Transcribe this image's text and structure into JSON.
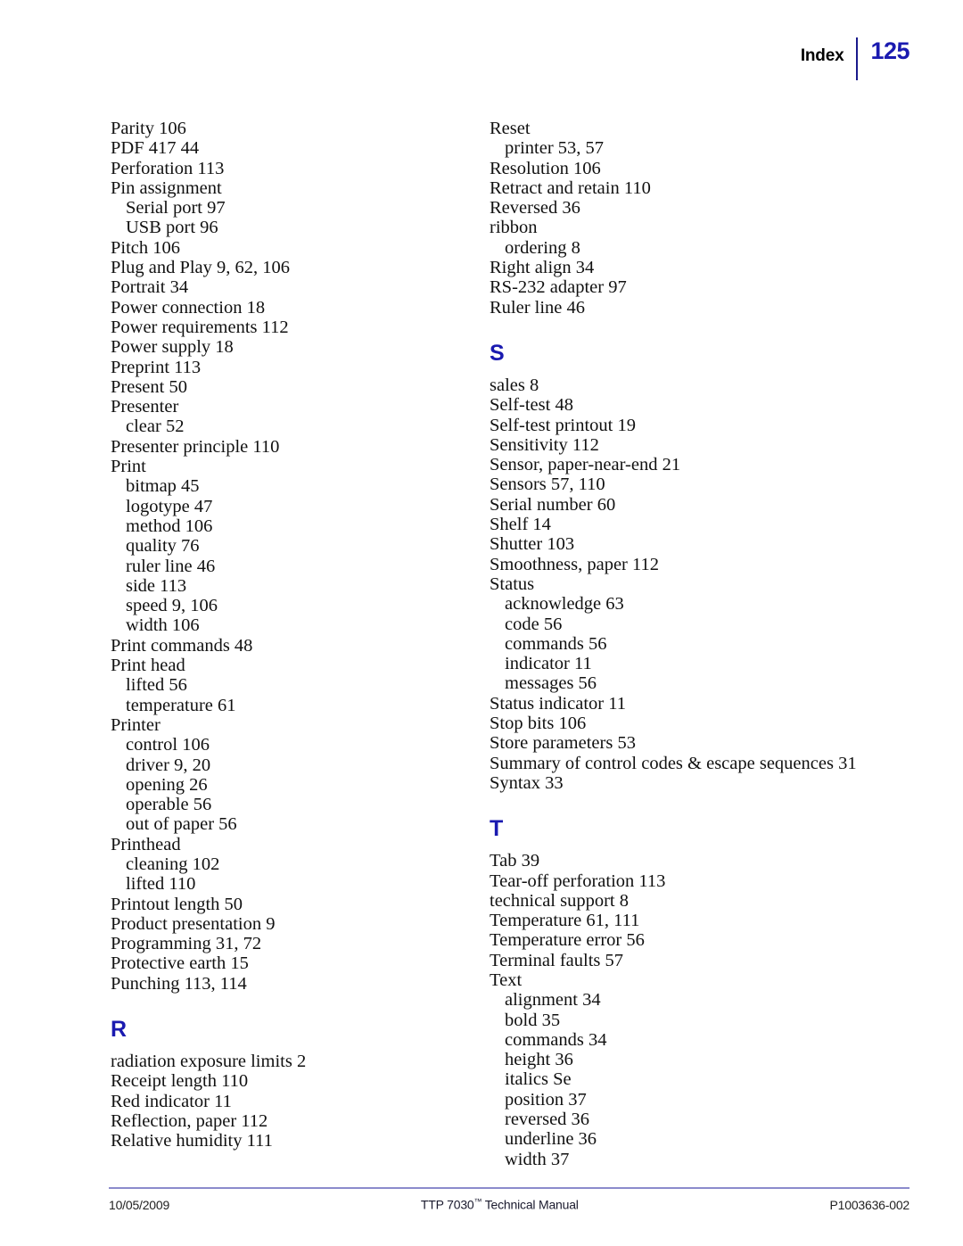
{
  "header": {
    "label": "Index",
    "page_number": "125",
    "divider_color": "#1a1a8c",
    "page_number_color": "#1a1ab0"
  },
  "footer": {
    "date": "10/05/2009",
    "manual_title": "TTP 7030",
    "manual_title_suffix": " Technical Manual",
    "trademark": "™",
    "document_number": "P1003636-002",
    "rule_color": "#8b8bcc"
  },
  "columns": {
    "left": [
      {
        "type": "entry",
        "level": 1,
        "text": "Parity 106"
      },
      {
        "type": "entry",
        "level": 1,
        "text": "PDF 417 44"
      },
      {
        "type": "entry",
        "level": 1,
        "text": "Perforation 113"
      },
      {
        "type": "entry",
        "level": 1,
        "text": "Pin assignment"
      },
      {
        "type": "entry",
        "level": 2,
        "text": "Serial port 97"
      },
      {
        "type": "entry",
        "level": 2,
        "text": "USB port 96"
      },
      {
        "type": "entry",
        "level": 1,
        "text": "Pitch 106"
      },
      {
        "type": "entry",
        "level": 1,
        "text": "Plug and Play 9, 62, 106"
      },
      {
        "type": "entry",
        "level": 1,
        "text": "Portrait 34"
      },
      {
        "type": "entry",
        "level": 1,
        "text": "Power connection 18"
      },
      {
        "type": "entry",
        "level": 1,
        "text": "Power requirements 112"
      },
      {
        "type": "entry",
        "level": 1,
        "text": "Power supply 18"
      },
      {
        "type": "entry",
        "level": 1,
        "text": "Preprint 113"
      },
      {
        "type": "entry",
        "level": 1,
        "text": "Present 50"
      },
      {
        "type": "entry",
        "level": 1,
        "text": "Presenter"
      },
      {
        "type": "entry",
        "level": 2,
        "text": "clear 52"
      },
      {
        "type": "entry",
        "level": 1,
        "text": "Presenter principle 110"
      },
      {
        "type": "entry",
        "level": 1,
        "text": "Print"
      },
      {
        "type": "entry",
        "level": 2,
        "text": "bitmap 45"
      },
      {
        "type": "entry",
        "level": 2,
        "text": "logotype 47"
      },
      {
        "type": "entry",
        "level": 2,
        "text": "method 106"
      },
      {
        "type": "entry",
        "level": 2,
        "text": "quality 76"
      },
      {
        "type": "entry",
        "level": 2,
        "text": "ruler line 46"
      },
      {
        "type": "entry",
        "level": 2,
        "text": "side 113"
      },
      {
        "type": "entry",
        "level": 2,
        "text": "speed 9, 106"
      },
      {
        "type": "entry",
        "level": 2,
        "text": "width 106"
      },
      {
        "type": "entry",
        "level": 1,
        "text": "Print commands 48"
      },
      {
        "type": "entry",
        "level": 1,
        "text": "Print head"
      },
      {
        "type": "entry",
        "level": 2,
        "text": "lifted 56"
      },
      {
        "type": "entry",
        "level": 2,
        "text": "temperature 61"
      },
      {
        "type": "entry",
        "level": 1,
        "text": "Printer"
      },
      {
        "type": "entry",
        "level": 2,
        "text": "control 106"
      },
      {
        "type": "entry",
        "level": 2,
        "text": "driver 9, 20"
      },
      {
        "type": "entry",
        "level": 2,
        "text": "opening 26"
      },
      {
        "type": "entry",
        "level": 2,
        "text": "operable 56"
      },
      {
        "type": "entry",
        "level": 2,
        "text": "out of paper 56"
      },
      {
        "type": "entry",
        "level": 1,
        "text": "Printhead"
      },
      {
        "type": "entry",
        "level": 2,
        "text": "cleaning 102"
      },
      {
        "type": "entry",
        "level": 2,
        "text": "lifted 110"
      },
      {
        "type": "entry",
        "level": 1,
        "text": "Printout length 50"
      },
      {
        "type": "entry",
        "level": 1,
        "text": "Product presentation 9"
      },
      {
        "type": "entry",
        "level": 1,
        "text": "Programming 31, 72"
      },
      {
        "type": "entry",
        "level": 1,
        "text": "Protective earth 15"
      },
      {
        "type": "entry",
        "level": 1,
        "text": "Punching 113, 114"
      },
      {
        "type": "letter",
        "text": "R"
      },
      {
        "type": "entry",
        "level": 1,
        "text": "radiation exposure limits 2"
      },
      {
        "type": "entry",
        "level": 1,
        "text": "Receipt length 110"
      },
      {
        "type": "entry",
        "level": 1,
        "text": "Red indicator 11"
      },
      {
        "type": "entry",
        "level": 1,
        "text": "Reflection, paper 112"
      },
      {
        "type": "entry",
        "level": 1,
        "text": "Relative humidity 111"
      }
    ],
    "right": [
      {
        "type": "entry",
        "level": 1,
        "text": "Reset"
      },
      {
        "type": "entry",
        "level": 2,
        "text": "printer 53, 57"
      },
      {
        "type": "entry",
        "level": 1,
        "text": "Resolution 106"
      },
      {
        "type": "entry",
        "level": 1,
        "text": "Retract and retain 110"
      },
      {
        "type": "entry",
        "level": 1,
        "text": "Reversed 36"
      },
      {
        "type": "entry",
        "level": 1,
        "text": "ribbon"
      },
      {
        "type": "entry",
        "level": 2,
        "text": "ordering 8"
      },
      {
        "type": "entry",
        "level": 1,
        "text": "Right align 34"
      },
      {
        "type": "entry",
        "level": 1,
        "text": "RS-232 adapter 97"
      },
      {
        "type": "entry",
        "level": 1,
        "text": "Ruler line 46"
      },
      {
        "type": "letter",
        "text": "S"
      },
      {
        "type": "entry",
        "level": 1,
        "text": "sales 8"
      },
      {
        "type": "entry",
        "level": 1,
        "text": "Self-test 48"
      },
      {
        "type": "entry",
        "level": 1,
        "text": "Self-test printout 19"
      },
      {
        "type": "entry",
        "level": 1,
        "text": "Sensitivity 112"
      },
      {
        "type": "entry",
        "level": 1,
        "text": "Sensor, paper-near-end 21"
      },
      {
        "type": "entry",
        "level": 1,
        "text": "Sensors 57, 110"
      },
      {
        "type": "entry",
        "level": 1,
        "text": "Serial number 60"
      },
      {
        "type": "entry",
        "level": 1,
        "text": "Shelf 14"
      },
      {
        "type": "entry",
        "level": 1,
        "text": "Shutter 103"
      },
      {
        "type": "entry",
        "level": 1,
        "text": "Smoothness, paper 112"
      },
      {
        "type": "entry",
        "level": 1,
        "text": "Status"
      },
      {
        "type": "entry",
        "level": 2,
        "text": "acknowledge 63"
      },
      {
        "type": "entry",
        "level": 2,
        "text": "code 56"
      },
      {
        "type": "entry",
        "level": 2,
        "text": "commands 56"
      },
      {
        "type": "entry",
        "level": 2,
        "text": "indicator 11"
      },
      {
        "type": "entry",
        "level": 2,
        "text": "messages 56"
      },
      {
        "type": "entry",
        "level": 1,
        "text": "Status indicator 11"
      },
      {
        "type": "entry",
        "level": 1,
        "text": "Stop bits 106"
      },
      {
        "type": "entry",
        "level": 1,
        "text": "Store parameters 53"
      },
      {
        "type": "entry",
        "level": 1,
        "text": "Summary of control codes & escape sequences 31"
      },
      {
        "type": "entry",
        "level": 1,
        "text": "Syntax 33"
      },
      {
        "type": "letter",
        "text": "T"
      },
      {
        "type": "entry",
        "level": 1,
        "text": "Tab 39"
      },
      {
        "type": "entry",
        "level": 1,
        "text": "Tear-off perforation 113"
      },
      {
        "type": "entry",
        "level": 1,
        "text": "technical support 8"
      },
      {
        "type": "entry",
        "level": 1,
        "text": "Temperature 61, 111"
      },
      {
        "type": "entry",
        "level": 1,
        "text": "Temperature error 56"
      },
      {
        "type": "entry",
        "level": 1,
        "text": "Terminal faults 57"
      },
      {
        "type": "entry",
        "level": 1,
        "text": "Text"
      },
      {
        "type": "entry",
        "level": 2,
        "text": "alignment 34"
      },
      {
        "type": "entry",
        "level": 2,
        "text": "bold 35"
      },
      {
        "type": "entry",
        "level": 2,
        "text": "commands 34"
      },
      {
        "type": "entry",
        "level": 2,
        "text": "height 36"
      },
      {
        "type": "entry",
        "level": 2,
        "text": "italics Se"
      },
      {
        "type": "entry",
        "level": 2,
        "text": "position 37"
      },
      {
        "type": "entry",
        "level": 2,
        "text": "reversed 36"
      },
      {
        "type": "entry",
        "level": 2,
        "text": "underline 36"
      },
      {
        "type": "entry",
        "level": 2,
        "text": "width 37"
      }
    ]
  }
}
